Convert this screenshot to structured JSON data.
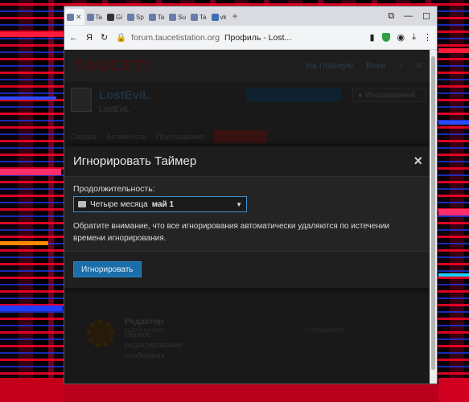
{
  "browser": {
    "tabs": [
      {
        "label": "",
        "active": true
      },
      {
        "label": "Ta"
      },
      {
        "label": "Gi"
      },
      {
        "label": "Sp"
      },
      {
        "label": "Ta"
      },
      {
        "label": "Su"
      },
      {
        "label": "Ta"
      },
      {
        "label": "vk"
      }
    ],
    "address_domain": "forum.taucetistation.org",
    "address_title": "Профиль - Lost...",
    "yandex_label": "Я"
  },
  "site": {
    "logo": "TAUCETI",
    "nav": {
      "home": "На главную",
      "wiki": "Вики"
    }
  },
  "profile": {
    "name": "LostEviL",
    "subname": "LostEviL",
    "follow_button": "",
    "ignore_button": "Игнорируемый",
    "tabs": [
      "Сводка",
      "Активность",
      "Приглашения"
    ]
  },
  "background_card": {
    "title": "Редактор",
    "description": "Первое редактирование сообщения",
    "left_caption": "сообщения",
    "right_caption": "сообщения"
  },
  "modal": {
    "title": "Игнорировать Таймер",
    "close": "×",
    "duration_label": "Продолжительность:",
    "duration_value": "Четыре месяца",
    "duration_date": "май 1",
    "notice": "Обратите внимание, что все игнорирования автоматически удаляются по истечении времени игнорирования.",
    "submit": "Игнорировать"
  }
}
